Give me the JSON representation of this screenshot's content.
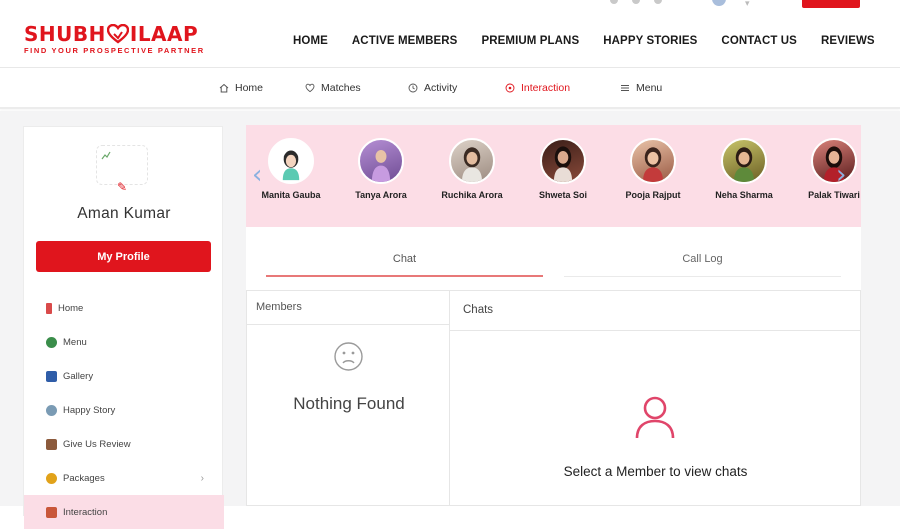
{
  "brand": {
    "name_part1": "SHUBH",
    "name_part2": "ILAAP",
    "tagline": "FIND YOUR PROSPECTIVE PARTNER",
    "accent_color": "#e0151d"
  },
  "main_nav": [
    "HOME",
    "ACTIVE MEMBERS",
    "PREMIUM PLANS",
    "HAPPY STORIES",
    "CONTACT US",
    "REVIEWS"
  ],
  "sub_nav": [
    {
      "label": "Home",
      "icon": "home-icon",
      "active": false
    },
    {
      "label": "Matches",
      "icon": "heart-icon",
      "active": false
    },
    {
      "label": "Activity",
      "icon": "activity-icon",
      "active": false
    },
    {
      "label": "Interaction",
      "icon": "interaction-icon",
      "active": true
    },
    {
      "label": "Menu",
      "icon": "menu-icon",
      "active": false
    }
  ],
  "sidebar": {
    "user_name": "Aman Kumar",
    "profile_button": "My Profile",
    "items": [
      {
        "label": "Home",
        "icon": "home-icon",
        "icon_color": "#d94a4a"
      },
      {
        "label": "Menu",
        "icon": "menu-icon",
        "icon_color": "#3a8d4a"
      },
      {
        "label": "Gallery",
        "icon": "gallery-icon",
        "icon_color": "#2f5da8"
      },
      {
        "label": "Happy Story",
        "icon": "happy-story-icon",
        "icon_color": "#7a9bb4"
      },
      {
        "label": "Give Us Review",
        "icon": "review-icon",
        "icon_color": "#8c5a3c"
      },
      {
        "label": "Packages",
        "icon": "packages-icon",
        "icon_color": "#e1a21a",
        "has_chevron": true
      },
      {
        "label": "Interaction",
        "icon": "interaction-icon",
        "icon_color": "#c9573a",
        "active": true
      }
    ]
  },
  "members_carousel": [
    {
      "name": "Manita Gauba",
      "bg": "#ffffff",
      "avatar": "cartoon"
    },
    {
      "name": "Tanya Arora",
      "bg": "#8e6bb0"
    },
    {
      "name": "Ruchika Arora",
      "bg": "#b9a89c"
    },
    {
      "name": "Shweta Soi",
      "bg": "#6b3a2e"
    },
    {
      "name": "Pooja Rajput",
      "bg": "#c48a6a"
    },
    {
      "name": "Neha Sharma",
      "bg": "#9a8a3a"
    },
    {
      "name": "Palak Tiwari",
      "bg": "#7a2a2a"
    }
  ],
  "chat": {
    "tabs": [
      "Chat",
      "Call Log"
    ],
    "active_tab": "Chat",
    "members_header": "Members",
    "empty_members": "Nothing Found",
    "chats_header": "Chats",
    "empty_chats": "Select a Member to view chats"
  }
}
